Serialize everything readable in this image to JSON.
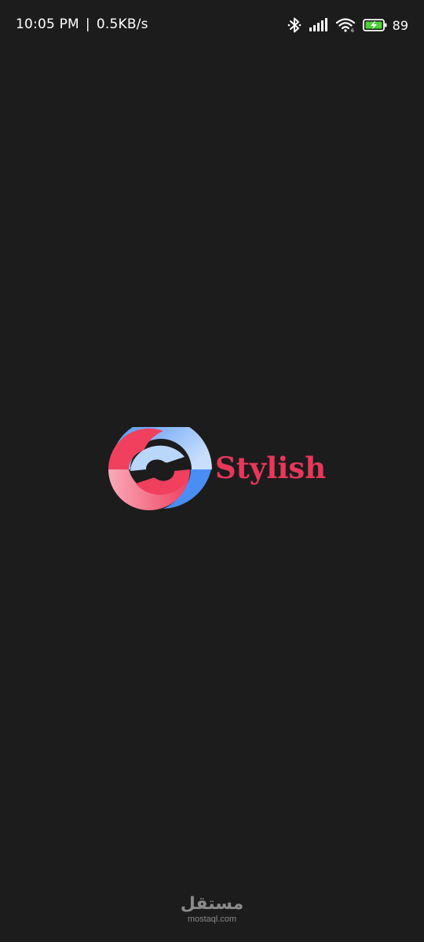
{
  "status_bar": {
    "time": "10:05 PM",
    "separator": "|",
    "network_speed": "0.5KB/s",
    "battery_percent": "89",
    "icons": [
      "bluetooth-icon",
      "signal-icon",
      "wifi-icon",
      "battery-charging-icon"
    ]
  },
  "splash": {
    "brand_name": "Stylish",
    "brand_color": "#e8375a",
    "logo_icon": "intertwined-rings-logo-icon",
    "logo_colors": {
      "red": "#f0405e",
      "pink_light": "#f9b2c0",
      "blue": "#4a8ef5",
      "blue_light": "#b9d6fb"
    }
  },
  "watermark": {
    "arabic_text": "مستقل",
    "latin_text": "mostaql.com"
  },
  "colors": {
    "background": "#1c1c1c",
    "status_text": "#ffffff",
    "watermark": "#8a8a8a",
    "battery_fill": "#4cd137"
  }
}
